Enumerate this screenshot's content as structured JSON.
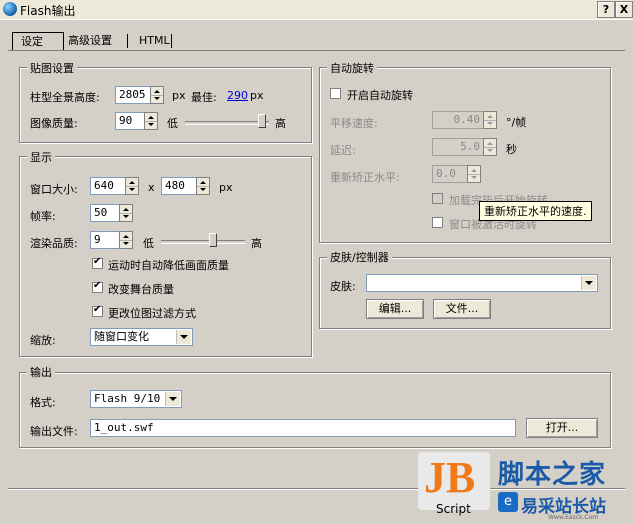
{
  "window": {
    "title": "Flash输出",
    "help_label": "?",
    "close_label": "X"
  },
  "tabs": [
    {
      "label": "设定"
    },
    {
      "label": "高级设置"
    },
    {
      "label": "HTML"
    }
  ],
  "texture": {
    "title": "贴图设置",
    "pano_height_label": "柱型全景高度:",
    "pano_height_value": "2805",
    "px_unit": "px",
    "best_label": "最佳:",
    "best_value": "290",
    "best_unit": "px",
    "quality_label": "图像质量:",
    "quality_value": "90",
    "quality_level": 0.92,
    "low_label": "低",
    "high_label": "高"
  },
  "display": {
    "title": "显示",
    "window_size_label": "窗口大小:",
    "width_value": "640",
    "x_label": "x",
    "height_value": "480",
    "px_unit": "px",
    "fps_label": "帧率:",
    "fps_value": "50",
    "render_label": "渲染品质:",
    "render_value": "9",
    "render_level": 0.62,
    "low_label": "低",
    "high_label": "高",
    "checks": [
      {
        "label": "运动时自动降低画面质量",
        "checked": true
      },
      {
        "label": "改变舞台质量",
        "checked": true
      },
      {
        "label": "更改位图过滤方式",
        "checked": true
      }
    ],
    "zoom_label": "缩放:",
    "zoom_value": "随窗口变化"
  },
  "autorotate": {
    "title": "自动旋转",
    "enable_label": "开启自动旋转",
    "pan_speed_label": "平移速度:",
    "pan_speed_value": "0.40",
    "pan_speed_unit": "°/帧",
    "delay_label": "延迟:",
    "delay_value": "5.0",
    "delay_unit": "秒",
    "recenter_label": "重新矫正水平:",
    "recenter_value": "0.0",
    "after_load_label": "加载完毕后开始旋转",
    "on_activate_label": "窗口被激活时旋转",
    "tooltip": "重新矫正水平的速度."
  },
  "skin": {
    "title": "皮肤/控制器",
    "skin_label": "皮肤:",
    "skin_value": "",
    "edit_button": "编辑...",
    "file_button": "文件..."
  },
  "output": {
    "title": "输出",
    "format_label": "格式:",
    "format_value": "Flash 9/10",
    "file_label": "输出文件:",
    "file_value": "1_out.swf",
    "open_button": "打开..."
  },
  "watermark": {
    "jb_text": "JB",
    "script_text": "Script",
    "site1": "脚本之家",
    "site2": "易采站长站",
    "url": "Www.Easck.Com"
  },
  "colors": {
    "link": "#0000cc",
    "tooltip_bg": "#ffffe1",
    "window_bg": "#d4d0c8"
  }
}
